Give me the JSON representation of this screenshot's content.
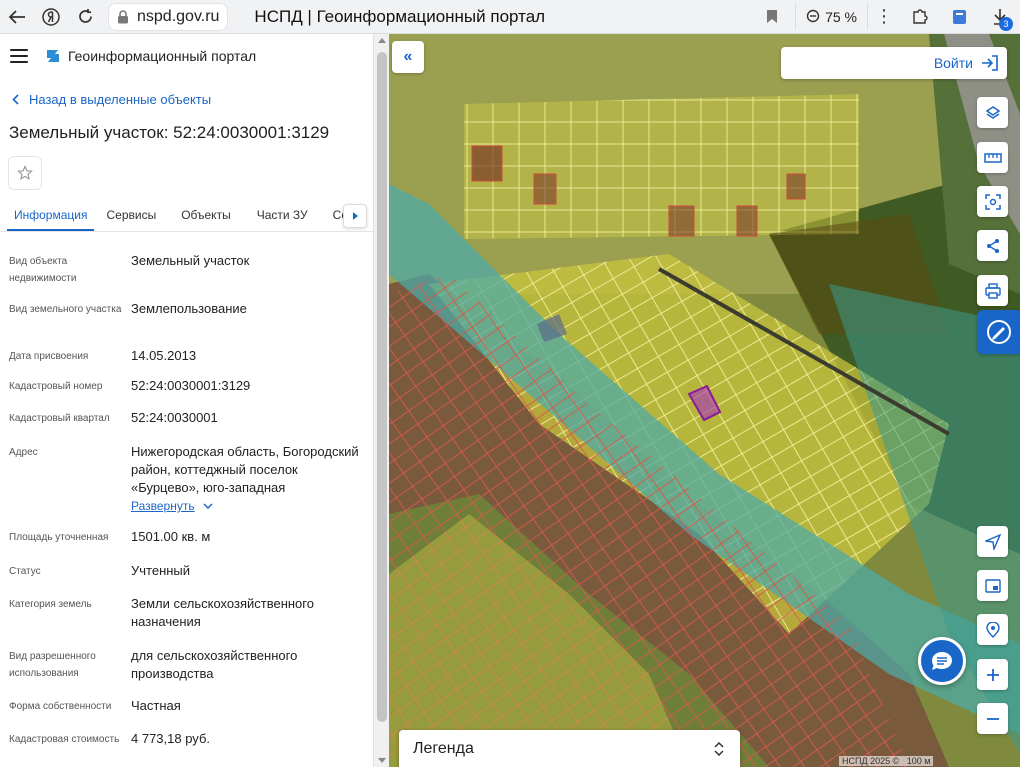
{
  "browser": {
    "url": "nspd.gov.ru",
    "tab_title": "НСПД | Геоинформационный портал",
    "zoom": "75 %",
    "ext_badge": "3"
  },
  "app": {
    "name": "Геоинформационный портал"
  },
  "panel": {
    "back_link": "Назад в выделенные объекты",
    "title": "Земельный участок: 52:24:0030001:3129",
    "tabs": [
      "Информация",
      "Сервисы",
      "Объекты",
      "Части ЗУ",
      "Сост"
    ],
    "fields": [
      {
        "label": "Вид объекта недвижимости",
        "value": "Земельный участок"
      },
      {
        "label": "Вид земельного участка",
        "value": "Землепользование"
      },
      {
        "label": "Дата присвоения",
        "value": "14.05.2013"
      },
      {
        "label": "Кадастровый номер",
        "value": "52:24:0030001:3129"
      },
      {
        "label": "Кадастровый квартал",
        "value": "52:24:0030001"
      },
      {
        "label": "Адрес",
        "value": "Нижегородская область, Богородский район, коттеджный поселок «Бурцево», юго-западная"
      },
      {
        "label": "Площадь уточненная",
        "value": "1501.00 кв. м"
      },
      {
        "label": "Статус",
        "value": "Учтенный"
      },
      {
        "label": "Категория земель",
        "value": "Земли сельскохозяйственного назначения"
      },
      {
        "label": "Вид разрешенного использования",
        "value": "для сельскохозяйственного производства"
      },
      {
        "label": "Форма собственности",
        "value": "Частная"
      },
      {
        "label": "Кадастровая стоимость",
        "value": "4 773,18 руб."
      }
    ],
    "expand_label": "Развернуть"
  },
  "map": {
    "login_label": "Войти",
    "legend_label": "Легенда",
    "attribution": "НСПД 2025 ©",
    "scale": "100 м"
  },
  "colors": {
    "accent": "#1a66c8"
  }
}
